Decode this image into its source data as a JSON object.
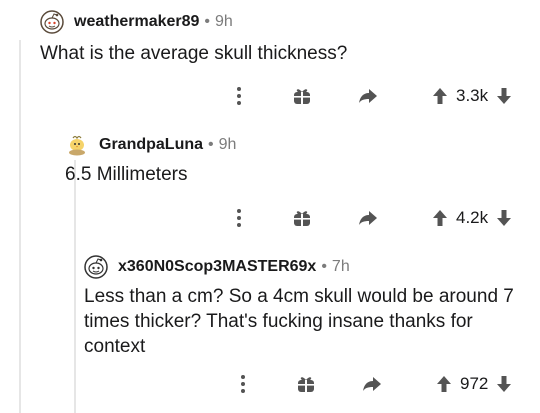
{
  "comments": [
    {
      "username": "weathermaker89",
      "separator": "•",
      "time": "9h",
      "body": "What is the average skull thickness?",
      "score": "3.3k",
      "avatar_icon": "snoo-avatar-icon"
    },
    {
      "username": "GrandpaLuna",
      "separator": "•",
      "time": "9h",
      "body": "6.5 Millimeters",
      "score": "4.2k",
      "avatar_icon": "chick-avatar-icon"
    },
    {
      "username": "x360N0Scop3MASTER69x",
      "separator": "•",
      "time": "7h",
      "body": "Less than a cm? So a 4cm skull would be around 7 times thicker? That's fucking insane thanks for context",
      "score": "972",
      "avatar_icon": "snoo-avatar-icon"
    }
  ],
  "icons": {
    "more": "more-options-icon",
    "award": "gift-award-icon",
    "reply": "reply-arrow-icon",
    "upvote": "upvote-arrow-icon",
    "downvote": "downvote-arrow-icon"
  },
  "colors": {
    "text": "#1a1a1b",
    "meta": "#7c7c7c",
    "icon": "#545454",
    "thread_line": "#e6e6e6"
  }
}
